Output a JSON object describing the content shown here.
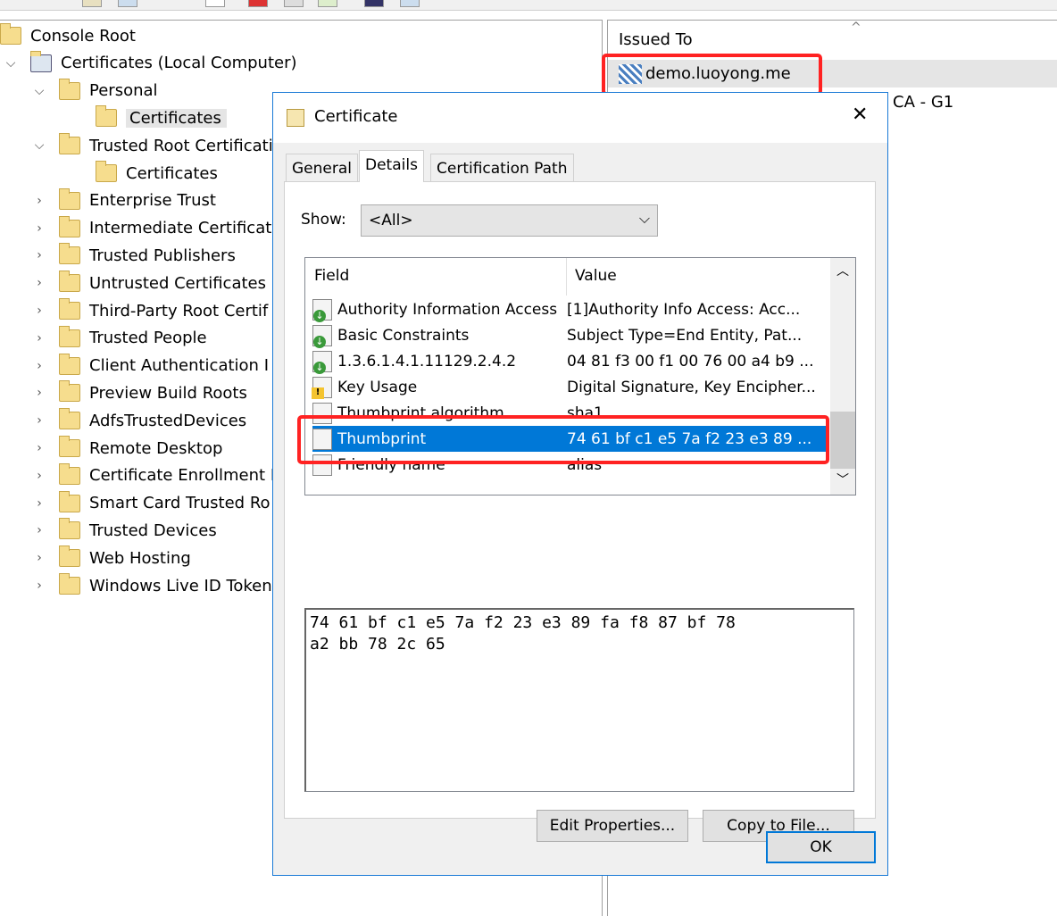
{
  "tree": {
    "items": [
      {
        "label": "Console Root",
        "level": 0,
        "expand": ""
      },
      {
        "label": "Certificates (Local Computer)",
        "level": 0,
        "expand": "open"
      },
      {
        "label": "Personal",
        "level": 1,
        "expand": "open"
      },
      {
        "label": "Certificates",
        "level": 2,
        "expand": "",
        "selected": true
      },
      {
        "label": "Trusted Root Certificati",
        "level": 1,
        "expand": "open"
      },
      {
        "label": "Certificates",
        "level": 2,
        "expand": ""
      },
      {
        "label": "Enterprise Trust",
        "level": 1,
        "expand": "closed"
      },
      {
        "label": "Intermediate Certificati",
        "level": 1,
        "expand": "closed"
      },
      {
        "label": "Trusted Publishers",
        "level": 1,
        "expand": "closed"
      },
      {
        "label": "Untrusted Certificates",
        "level": 1,
        "expand": "closed"
      },
      {
        "label": "Third-Party Root Certif",
        "level": 1,
        "expand": "closed"
      },
      {
        "label": "Trusted People",
        "level": 1,
        "expand": "closed"
      },
      {
        "label": "Client Authentication I",
        "level": 1,
        "expand": "closed"
      },
      {
        "label": "Preview Build Roots",
        "level": 1,
        "expand": "closed"
      },
      {
        "label": "AdfsTrustedDevices",
        "level": 1,
        "expand": "closed"
      },
      {
        "label": "Remote Desktop",
        "level": 1,
        "expand": "closed"
      },
      {
        "label": "Certificate Enrollment I",
        "level": 1,
        "expand": "closed"
      },
      {
        "label": "Smart Card Trusted Ro",
        "level": 1,
        "expand": "closed"
      },
      {
        "label": "Trusted Devices",
        "level": 1,
        "expand": "closed"
      },
      {
        "label": "Web Hosting",
        "level": 1,
        "expand": "closed"
      },
      {
        "label": "Windows Live ID Token",
        "level": 1,
        "expand": "closed"
      }
    ]
  },
  "right": {
    "column": "Issued To",
    "rows": [
      "demo.luoyong.me"
    ],
    "partial_text": "CA - G1"
  },
  "dialog": {
    "title": "Certificate",
    "tabs": [
      "General",
      "Details",
      "Certification Path"
    ],
    "active_tab": "Details",
    "show_label": "Show:",
    "show_value": "<All>",
    "columns": [
      "Field",
      "Value"
    ],
    "fields": [
      {
        "field": "Authority Information Access",
        "value": "[1]Authority Info Access: Acc...",
        "icon": "dl"
      },
      {
        "field": "Basic Constraints",
        "value": "Subject Type=End Entity, Pat...",
        "icon": "dl"
      },
      {
        "field": "1.3.6.1.4.1.11129.2.4.2",
        "value": "04 81 f3 00 f1 00 76 00 a4 b9 ...",
        "icon": "dl"
      },
      {
        "field": "Key Usage",
        "value": "Digital Signature, Key Encipher...",
        "icon": "warn"
      },
      {
        "field": "Thumbprint algorithm",
        "value": "sha1",
        "icon": "doc"
      },
      {
        "field": "Thumbprint",
        "value": "74 61 bf c1 e5 7a f2 23 e3 89 ...",
        "icon": "doc",
        "selected": true
      },
      {
        "field": "Friendly name",
        "value": "alias",
        "icon": "doc"
      }
    ],
    "detail_text": "74 61 bf c1 e5 7a f2 23 e3 89 fa f8 87 bf 78\na2 bb 78 2c 65",
    "edit_button": "Edit Properties...",
    "copy_button": "Copy to File...",
    "ok_button": "OK",
    "close": "✕"
  },
  "colors": {
    "selection": "#0078d7",
    "highlight_box": "#ff2222",
    "dialog_border": "#1a7ad6"
  }
}
